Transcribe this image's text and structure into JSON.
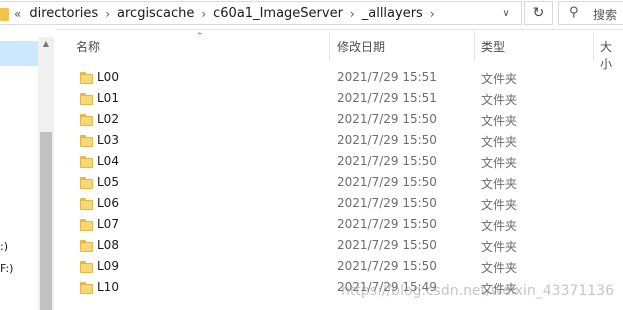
{
  "breadcrumb": {
    "overflow": "«",
    "items": [
      "directories",
      "arcgiscache",
      "c60a1_ImageServer",
      "_alllayers"
    ],
    "separator": "›"
  },
  "address_bar": {
    "dropdown_icon": "chevron-down-icon",
    "refresh_icon": "refresh-icon"
  },
  "search": {
    "placeholder": "搜索",
    "icon": "search-icon"
  },
  "nav_pane": {
    "labels": [
      ":)",
      "F:)"
    ]
  },
  "columns": {
    "name": "名称",
    "date": "修改日期",
    "type": "类型",
    "size": "大小"
  },
  "files": [
    {
      "name": "L00",
      "date": "2021/7/29 15:51",
      "type": "文件夹"
    },
    {
      "name": "L01",
      "date": "2021/7/29 15:51",
      "type": "文件夹"
    },
    {
      "name": "L02",
      "date": "2021/7/29 15:50",
      "type": "文件夹"
    },
    {
      "name": "L03",
      "date": "2021/7/29 15:50",
      "type": "文件夹"
    },
    {
      "name": "L04",
      "date": "2021/7/29 15:50",
      "type": "文件夹"
    },
    {
      "name": "L05",
      "date": "2021/7/29 15:50",
      "type": "文件夹"
    },
    {
      "name": "L06",
      "date": "2021/7/29 15:50",
      "type": "文件夹"
    },
    {
      "name": "L07",
      "date": "2021/7/29 15:50",
      "type": "文件夹"
    },
    {
      "name": "L08",
      "date": "2021/7/29 15:50",
      "type": "文件夹"
    },
    {
      "name": "L09",
      "date": "2021/7/29 15:50",
      "type": "文件夹"
    },
    {
      "name": "L10",
      "date": "2021/7/29 15:49",
      "type": "文件夹"
    }
  ],
  "watermark": "https://blog.csdn.net/weixin_43371136",
  "colors": {
    "selection": "#cce8ff",
    "folder": "#f8d775",
    "secondary_text": "#6d6d6d"
  }
}
